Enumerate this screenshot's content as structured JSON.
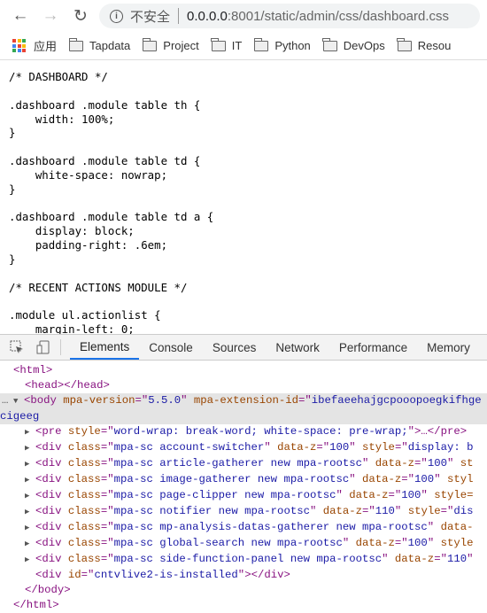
{
  "browser": {
    "url_insecure_label": "不安全",
    "url_host": "0.0.0.0",
    "url_path": ":8001/static/admin/css/dashboard.css",
    "bookmarks": [
      {
        "label": "应用",
        "icon": "apps-icon"
      },
      {
        "label": "Tapdata",
        "icon": "folder-icon"
      },
      {
        "label": "Project",
        "icon": "folder-icon"
      },
      {
        "label": "IT",
        "icon": "folder-icon"
      },
      {
        "label": "Python",
        "icon": "folder-icon"
      },
      {
        "label": "DevOps",
        "icon": "folder-icon"
      },
      {
        "label": "Resou",
        "icon": "folder-icon"
      }
    ]
  },
  "css_source": [
    "/* DASHBOARD */",
    "",
    ".dashboard .module table th {",
    "    width: 100%;",
    "}",
    "",
    ".dashboard .module table td {",
    "    white-space: nowrap;",
    "}",
    "",
    ".dashboard .module table td a {",
    "    display: block;",
    "    padding-right: .6em;",
    "}",
    "",
    "/* RECENT ACTIONS MODULE */",
    "",
    ".module ul.actionlist {",
    "    margin-left: 0;"
  ],
  "devtools": {
    "tabs": [
      "Elements",
      "Console",
      "Sources",
      "Network",
      "Performance",
      "Memory"
    ],
    "active_tab": "Elements",
    "tree": [
      {
        "indent": 1,
        "arrow": "",
        "tokens": [
          [
            "tag",
            "<html>"
          ]
        ]
      },
      {
        "indent": 2,
        "arrow": "",
        "tokens": [
          [
            "tag",
            "<head></head>"
          ]
        ]
      },
      {
        "indent": 1,
        "arrow": "▼",
        "selected": true,
        "tokens": [
          [
            "tag",
            "<body "
          ],
          [
            "attr",
            "mpa-version"
          ],
          [
            "punc",
            "=\""
          ],
          [
            "val",
            "5.5.0"
          ],
          [
            "punc",
            "\" "
          ],
          [
            "attr",
            "mpa-extension-id"
          ],
          [
            "punc",
            "=\""
          ],
          [
            "val",
            "ibefaeehajgcpooopoegkifhgecigeeg"
          ]
        ]
      },
      {
        "indent": 2,
        "arrow": "▶",
        "tokens": [
          [
            "tag",
            "<pre "
          ],
          [
            "attr",
            "style"
          ],
          [
            "punc",
            "=\""
          ],
          [
            "val",
            "word-wrap: break-word; white-space: pre-wrap;"
          ],
          [
            "punc",
            "\""
          ],
          [
            "tag",
            ">…</pre>"
          ]
        ]
      },
      {
        "indent": 2,
        "arrow": "▶",
        "tokens": [
          [
            "tag",
            "<div "
          ],
          [
            "attr",
            "class"
          ],
          [
            "punc",
            "=\""
          ],
          [
            "val",
            "mpa-sc account-switcher"
          ],
          [
            "punc",
            "\" "
          ],
          [
            "attr",
            "data-z"
          ],
          [
            "punc",
            "=\""
          ],
          [
            "val",
            "100"
          ],
          [
            "punc",
            "\" "
          ],
          [
            "attr",
            "style"
          ],
          [
            "punc",
            "=\""
          ],
          [
            "val",
            "display: b"
          ]
        ]
      },
      {
        "indent": 2,
        "arrow": "▶",
        "tokens": [
          [
            "tag",
            "<div "
          ],
          [
            "attr",
            "class"
          ],
          [
            "punc",
            "=\""
          ],
          [
            "val",
            "mpa-sc article-gatherer new mpa-rootsc"
          ],
          [
            "punc",
            "\" "
          ],
          [
            "attr",
            "data-z"
          ],
          [
            "punc",
            "=\""
          ],
          [
            "val",
            "100"
          ],
          [
            "punc",
            "\" "
          ],
          [
            "attr",
            "st"
          ]
        ]
      },
      {
        "indent": 2,
        "arrow": "▶",
        "tokens": [
          [
            "tag",
            "<div "
          ],
          [
            "attr",
            "class"
          ],
          [
            "punc",
            "=\""
          ],
          [
            "val",
            "mpa-sc image-gatherer new mpa-rootsc"
          ],
          [
            "punc",
            "\" "
          ],
          [
            "attr",
            "data-z"
          ],
          [
            "punc",
            "=\""
          ],
          [
            "val",
            "100"
          ],
          [
            "punc",
            "\" "
          ],
          [
            "attr",
            "styl"
          ]
        ]
      },
      {
        "indent": 2,
        "arrow": "▶",
        "tokens": [
          [
            "tag",
            "<div "
          ],
          [
            "attr",
            "class"
          ],
          [
            "punc",
            "=\""
          ],
          [
            "val",
            "mpa-sc page-clipper new mpa-rootsc"
          ],
          [
            "punc",
            "\" "
          ],
          [
            "attr",
            "data-z"
          ],
          [
            "punc",
            "=\""
          ],
          [
            "val",
            "100"
          ],
          [
            "punc",
            "\" "
          ],
          [
            "attr",
            "style="
          ]
        ]
      },
      {
        "indent": 2,
        "arrow": "▶",
        "tokens": [
          [
            "tag",
            "<div "
          ],
          [
            "attr",
            "class"
          ],
          [
            "punc",
            "=\""
          ],
          [
            "val",
            "mpa-sc notifier new mpa-rootsc"
          ],
          [
            "punc",
            "\" "
          ],
          [
            "attr",
            "data-z"
          ],
          [
            "punc",
            "=\""
          ],
          [
            "val",
            "110"
          ],
          [
            "punc",
            "\" "
          ],
          [
            "attr",
            "style"
          ],
          [
            "punc",
            "=\""
          ],
          [
            "val",
            "dis"
          ]
        ]
      },
      {
        "indent": 2,
        "arrow": "▶",
        "tokens": [
          [
            "tag",
            "<div "
          ],
          [
            "attr",
            "class"
          ],
          [
            "punc",
            "=\""
          ],
          [
            "val",
            "mpa-sc mp-analysis-datas-gatherer new mpa-rootsc"
          ],
          [
            "punc",
            "\" "
          ],
          [
            "attr",
            "data-"
          ]
        ]
      },
      {
        "indent": 2,
        "arrow": "▶",
        "tokens": [
          [
            "tag",
            "<div "
          ],
          [
            "attr",
            "class"
          ],
          [
            "punc",
            "=\""
          ],
          [
            "val",
            "mpa-sc global-search new mpa-rootsc"
          ],
          [
            "punc",
            "\" "
          ],
          [
            "attr",
            "data-z"
          ],
          [
            "punc",
            "=\""
          ],
          [
            "val",
            "100"
          ],
          [
            "punc",
            "\" "
          ],
          [
            "attr",
            "style"
          ]
        ]
      },
      {
        "indent": 2,
        "arrow": "▶",
        "tokens": [
          [
            "tag",
            "<div "
          ],
          [
            "attr",
            "class"
          ],
          [
            "punc",
            "=\""
          ],
          [
            "val",
            "mpa-sc side-function-panel new mpa-rootsc"
          ],
          [
            "punc",
            "\" "
          ],
          [
            "attr",
            "data-z"
          ],
          [
            "punc",
            "=\""
          ],
          [
            "val",
            "110"
          ],
          [
            "punc",
            "\""
          ]
        ]
      },
      {
        "indent": 3,
        "arrow": "",
        "tokens": [
          [
            "tag",
            "<div "
          ],
          [
            "attr",
            "id"
          ],
          [
            "punc",
            "=\""
          ],
          [
            "val",
            "cntvlive2-is-installed"
          ],
          [
            "punc",
            "\""
          ],
          [
            "tag",
            "></div>"
          ]
        ]
      },
      {
        "indent": 2,
        "arrow": "",
        "tokens": [
          [
            "tag",
            "</body>"
          ]
        ]
      },
      {
        "indent": 1,
        "arrow": "",
        "tokens": [
          [
            "tag",
            "</html>"
          ]
        ]
      }
    ]
  }
}
